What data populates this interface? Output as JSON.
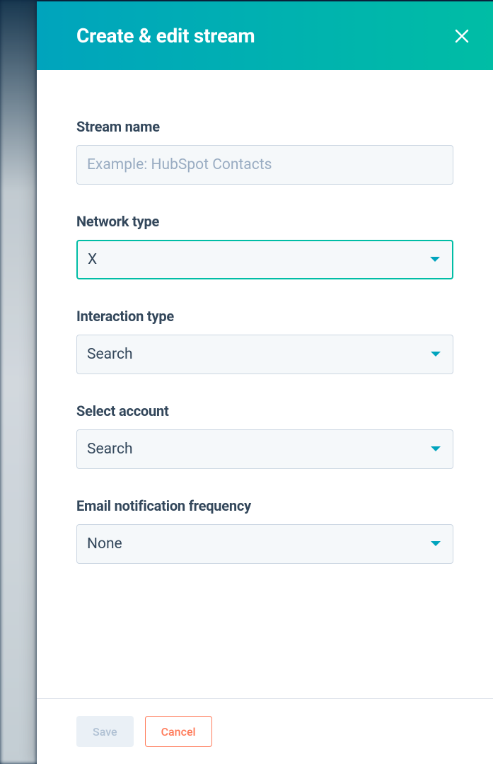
{
  "header": {
    "title": "Create & edit stream"
  },
  "form": {
    "stream_name": {
      "label": "Stream name",
      "placeholder": "Example: HubSpot Contacts",
      "value": ""
    },
    "network_type": {
      "label": "Network type",
      "value": "X"
    },
    "interaction_type": {
      "label": "Interaction type",
      "value": "Search"
    },
    "select_account": {
      "label": "Select account",
      "value": "Search"
    },
    "email_frequency": {
      "label": "Email notification frequency",
      "value": "None"
    }
  },
  "footer": {
    "save_label": "Save",
    "cancel_label": "Cancel"
  }
}
